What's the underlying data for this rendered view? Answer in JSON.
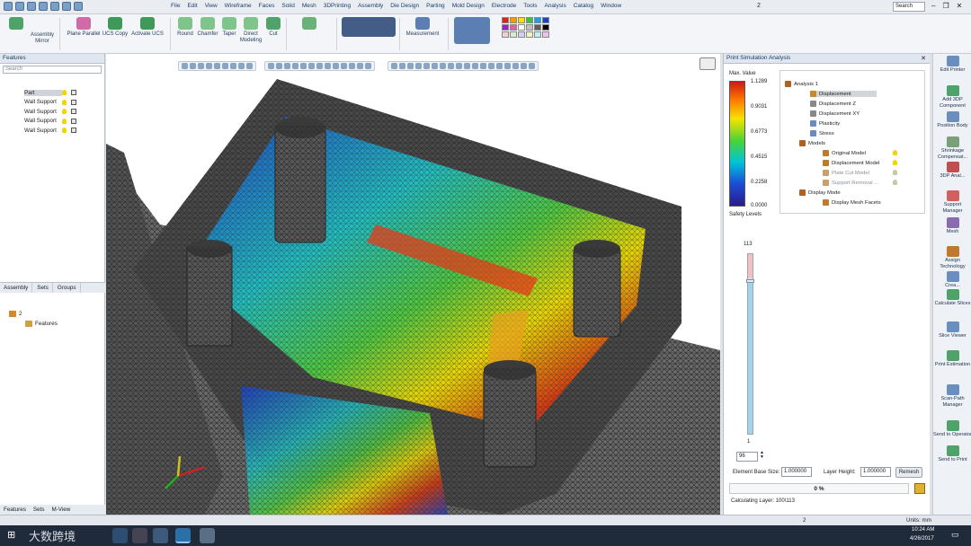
{
  "menu": [
    "File",
    "Edit",
    "View",
    "Wireframe",
    "Faces",
    "Solid",
    "Mesh",
    "3DPrinting",
    "Assembly",
    "Die Design",
    "Parting",
    "Mold Design",
    "Electrode",
    "Tools",
    "Analysis",
    "Catalog",
    "Window"
  ],
  "document_title": "2",
  "search_placeholder": "Search",
  "ribbon": {
    "assembly_mirror": "Assembly Mirror",
    "plane_parallel": "Plane Parallel",
    "ucs_copy": "UCS Copy",
    "activate_ucs": "Activate UCS",
    "round": "Round",
    "chamfer": "Chamfer",
    "taper": "Taper",
    "direct_modeling": "Direct Modeling",
    "cut": "Cut",
    "measurement": "Measurement"
  },
  "features_panel": {
    "title": "Features",
    "search_placeholder": "Search",
    "rows": [
      "Part",
      "Wall Support",
      "Wall Support",
      "Wall Support",
      "Wall Support"
    ]
  },
  "left_tabs": [
    "Assembly",
    "Sets",
    "Groups"
  ],
  "assembly_tree": {
    "root": "2",
    "child": "Features"
  },
  "bottom_tabs": [
    "Features",
    "Sets",
    "M-View"
  ],
  "analysis": {
    "title": "Print Simulation Analysis",
    "max_value_label": "Max. Value",
    "legend_values": [
      "1.1289",
      "0.9031",
      "0.6773",
      "0.4515",
      "0.2258",
      "0.0000"
    ],
    "safety_levels": "Safety Levels",
    "tree": [
      "Analysis 1",
      "Displacement",
      "Displacement Z",
      "Displacement XY",
      "Plasticity",
      "Stress",
      "Models",
      "Original Model",
      "Displacement Model",
      "Plate Cut Model",
      "Support Removal ...",
      "Display Mode",
      "Display Mesh Facets"
    ],
    "slider_max": "113",
    "slider_min": "1",
    "slider_value": "96",
    "slider_fraction": 0.85,
    "element_base_size_label": "Element Base Size:",
    "element_base_size": "1.000000",
    "layer_height_label": "Layer Height:",
    "layer_height": "1.000000",
    "remesh": "Remesh",
    "progress": "0 %",
    "calculating": "Calculating Layer: 100\\113"
  },
  "commands": [
    "Edit Printer",
    "Add 3DP Component",
    "Position Body",
    "Shrinkage Compensat...",
    "3DP Anal...",
    "Support Manager",
    "Mesh",
    "Assign Technology",
    "Crea...",
    "Calculate Slices",
    "Slice Viewer",
    "Print Estimation",
    "Scan-Path Manager",
    "Send to Operator",
    "Send to Print"
  ],
  "status": {
    "center": "2",
    "units": "Units: mm"
  },
  "clock": {
    "time": "10:24 AM",
    "date": "4/26/2017"
  },
  "watermark": "大数跨境"
}
